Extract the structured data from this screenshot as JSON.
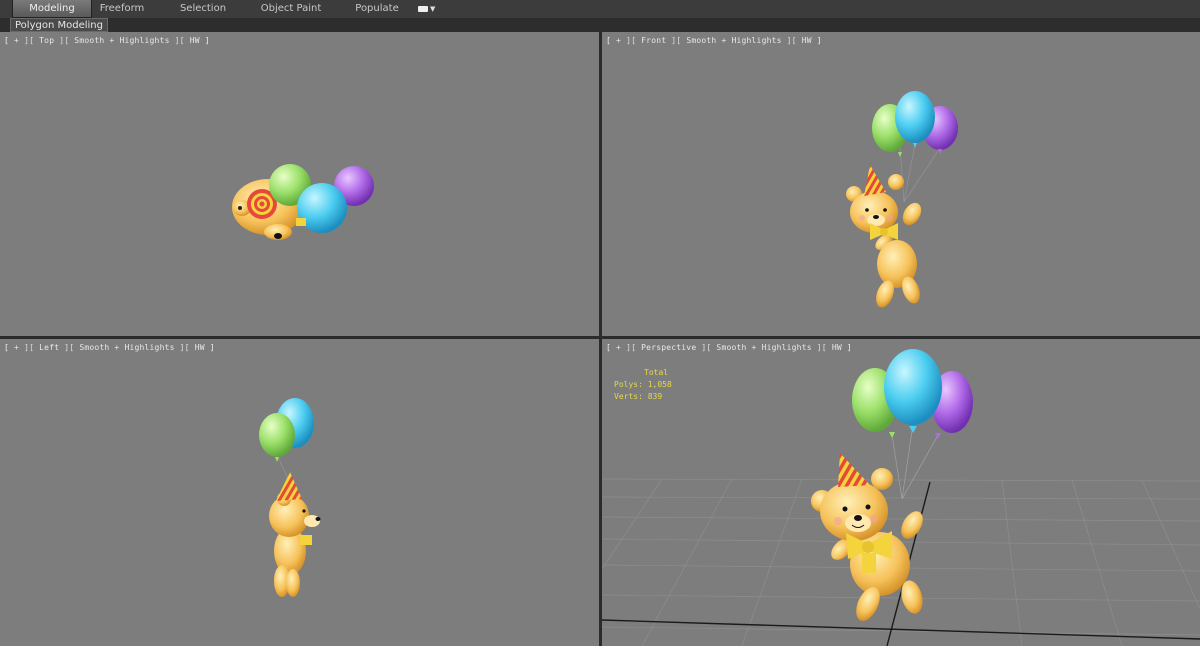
{
  "ribbon": {
    "tabs": [
      {
        "label": "Modeling",
        "active": true
      },
      {
        "label": "Freeform",
        "active": false
      },
      {
        "label": "Selection",
        "active": false
      },
      {
        "label": "Object Paint",
        "active": false
      },
      {
        "label": "Populate",
        "active": false
      }
    ],
    "dropdown_icon": "camera-icon"
  },
  "subbar": {
    "panel_label": "Polygon Modeling"
  },
  "viewports": {
    "top": {
      "plus": "+",
      "view": "Top",
      "shading": "Smooth + Highlights",
      "mode": "HW"
    },
    "front": {
      "plus": "+",
      "view": "Front",
      "shading": "Smooth + Highlights",
      "mode": "HW"
    },
    "left": {
      "plus": "+",
      "view": "Left",
      "shading": "Smooth + Highlights",
      "mode": "HW"
    },
    "perspective": {
      "plus": "+",
      "view": "Perspective",
      "shading": "Smooth + Highlights",
      "mode": "HW"
    }
  },
  "stats": {
    "total_label": "Total",
    "polys_label": "Polys:",
    "polys_value": "1,058",
    "verts_label": "Verts:",
    "verts_value": "839"
  },
  "colors": {
    "viewport_bg": "#7d7d7d",
    "balloon_green": "#9be06a",
    "balloon_blue": "#4ccdf0",
    "balloon_purple": "#b06ae8",
    "bear_body": "#f6c25a",
    "hat_red": "#e8483a",
    "hat_yellow": "#f3d43c",
    "stats_text": "#e8d84a"
  }
}
